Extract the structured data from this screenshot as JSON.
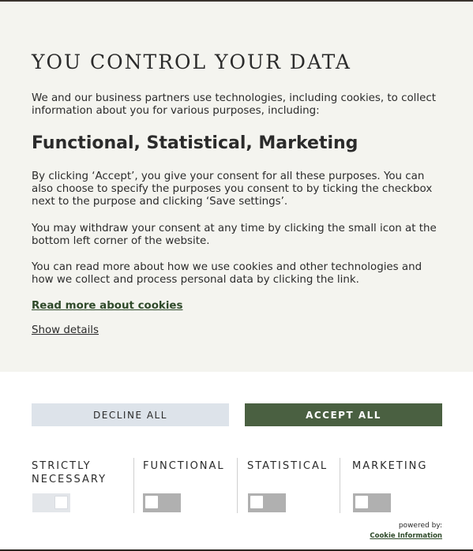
{
  "dialog": {
    "title": "YOU CONTROL YOUR DATA",
    "intro": "We and our business partners use technologies, including cookies, to collect information about you for various purposes, including:",
    "purposes": "Functional, Statistical, Marketing",
    "consent_text": "By clicking ‘Accept’, you give your consent for all these purposes. You can also choose to specify the purposes you consent to by ticking the checkbox next to the purpose and clicking ‘Save settings’.",
    "withdraw_text": "You may withdraw your consent at any time by clicking the small icon at the bottom left corner of the website.",
    "more_text": "You can read more about how we use cookies and other technologies and how we collect and process personal data by clicking the link.",
    "read_more_link": "Read more about cookies",
    "show_details_link": "Show details"
  },
  "buttons": {
    "decline_label": "DECLINE ALL",
    "accept_label": "ACCEPT ALL"
  },
  "categories": [
    {
      "label": "STRICTLY NECESSARY",
      "enabled": true,
      "disabled": true
    },
    {
      "label": "FUNCTIONAL",
      "enabled": false,
      "disabled": false
    },
    {
      "label": "STATISTICAL",
      "enabled": false,
      "disabled": false
    },
    {
      "label": "MARKETING",
      "enabled": false,
      "disabled": false
    }
  ],
  "footer": {
    "powered_by": "powered by:",
    "brand_link": "Cookie Information"
  },
  "colors": {
    "accent": "#4a6041",
    "link": "#2f4a2a",
    "panel_bg": "#f4f4ef",
    "decline_bg": "#dde3ea"
  }
}
